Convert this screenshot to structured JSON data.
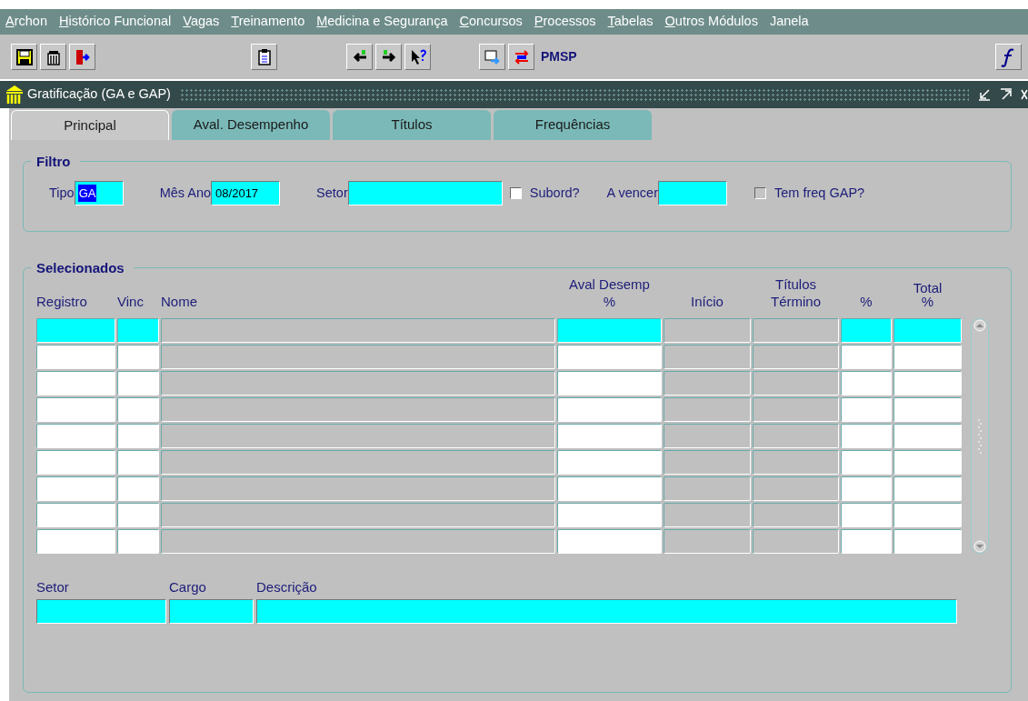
{
  "menu": [
    {
      "label": "Archon",
      "underlined": true
    },
    {
      "label": "Histórico Funcional",
      "underlined": true
    },
    {
      "label": "Vagas",
      "underlined": true
    },
    {
      "label": "Treinamento",
      "underlined": true
    },
    {
      "label": "Medicina e Segurança",
      "underlined": true
    },
    {
      "label": "Concursos",
      "underlined": true
    },
    {
      "label": "Processos",
      "underlined": true
    },
    {
      "label": "Tabelas",
      "underlined": true
    },
    {
      "label": "Outros Módulos",
      "underlined": true
    },
    {
      "label": "Janela",
      "underlined": false
    }
  ],
  "toolbar": {
    "label": "PMSP"
  },
  "window": {
    "title": "Gratificação (GA e GAP)"
  },
  "tabs": [
    {
      "label": "Principal",
      "selected": true
    },
    {
      "label": "Aval. Desempenho",
      "selected": false
    },
    {
      "label": "Títulos",
      "selected": false
    },
    {
      "label": "Frequências",
      "selected": false
    }
  ],
  "filter": {
    "title": "Filtro",
    "fields": [
      {
        "kind": "text",
        "label": "Tipo",
        "value": "GA",
        "highlighted": true
      },
      {
        "kind": "text",
        "label": "Mês Ano",
        "value": "08/2017",
        "highlighted": false
      },
      {
        "kind": "text",
        "label": "Setor"
      },
      {
        "kind": "checkbox",
        "label": "Subord?",
        "checked": false,
        "disabled": false
      },
      {
        "kind": "text",
        "label": "A vencer"
      },
      {
        "kind": "checkbox",
        "label": "Tem freq GAP?",
        "checked": false,
        "disabled": true
      }
    ]
  },
  "selected": {
    "title": "Selecionados",
    "group_headers": [
      {
        "label": "Aval Desemp"
      },
      {
        "label": "Títulos"
      },
      {
        "label": "Total"
      }
    ],
    "columns": [
      {
        "label": "Registro",
        "kind": "field"
      },
      {
        "label": "Vinc",
        "kind": "field"
      },
      {
        "label": "Nome",
        "kind": "display"
      },
      {
        "label": "%",
        "kind": "field"
      },
      {
        "label": "Início",
        "kind": "display"
      },
      {
        "label": "Término",
        "kind": "display"
      },
      {
        "label": "%",
        "kind": "field"
      },
      {
        "label": "%",
        "kind": "field"
      }
    ],
    "rows": [
      {
        "current": true
      },
      {
        "current": false
      },
      {
        "current": false
      },
      {
        "current": false
      },
      {
        "current": false
      },
      {
        "current": false
      },
      {
        "current": false
      },
      {
        "current": false
      },
      {
        "current": false
      }
    ],
    "details": [
      {
        "label": "Setor"
      },
      {
        "label": "Cargo"
      },
      {
        "label": "Descrição"
      }
    ]
  }
}
